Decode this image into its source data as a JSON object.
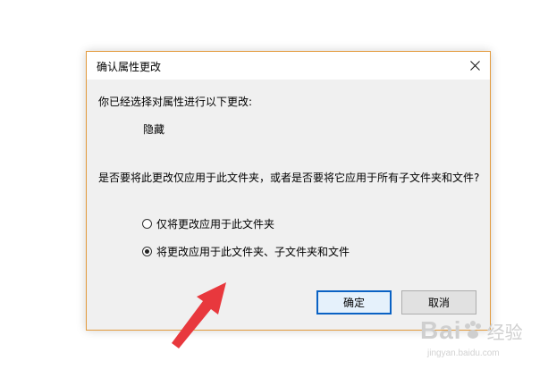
{
  "dialog": {
    "title": "确认属性更改",
    "intro": "你已经选择对属性进行以下更改:",
    "change": "隐藏",
    "question": "是否要将此更改仅应用于此文件夹，或者是否要将它应用于所有子文件夹和文件?",
    "options": [
      {
        "label": "仅将更改应用于此文件夹",
        "selected": false
      },
      {
        "label": "将更改应用于此文件夹、子文件夹和文件",
        "selected": true
      }
    ],
    "ok_label": "确定",
    "cancel_label": "取消",
    "close_icon": "close-icon"
  },
  "watermark": {
    "brand": "Bai",
    "brand2": "经验",
    "url": "jingyan.baidu.com"
  },
  "colors": {
    "dialog_border": "#e39a3c",
    "arrow": "#e8383d",
    "ok_border": "#0a62c4"
  }
}
